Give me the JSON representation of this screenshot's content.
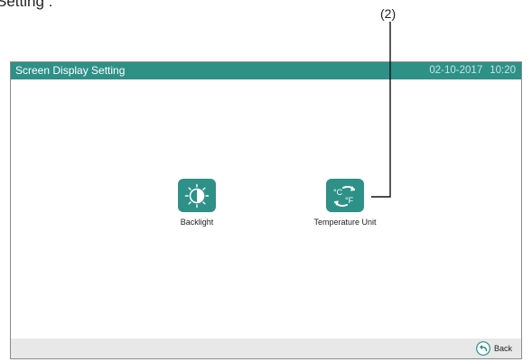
{
  "document": {
    "heading": "Setting :",
    "callout": "(2)"
  },
  "titlebar": {
    "title": "Screen Display Setting",
    "date": "02-10-2017",
    "time": "10:20",
    "color": "#2e9188"
  },
  "tiles": [
    {
      "label": "Backlight",
      "icon": "backlight-icon"
    },
    {
      "label": "Temperature Unit",
      "icon": "temperature-unit-icon"
    }
  ],
  "bottombar": {
    "back_label": "Back",
    "back_icon": "back-arrow-icon",
    "back_color": "#2e9188"
  }
}
